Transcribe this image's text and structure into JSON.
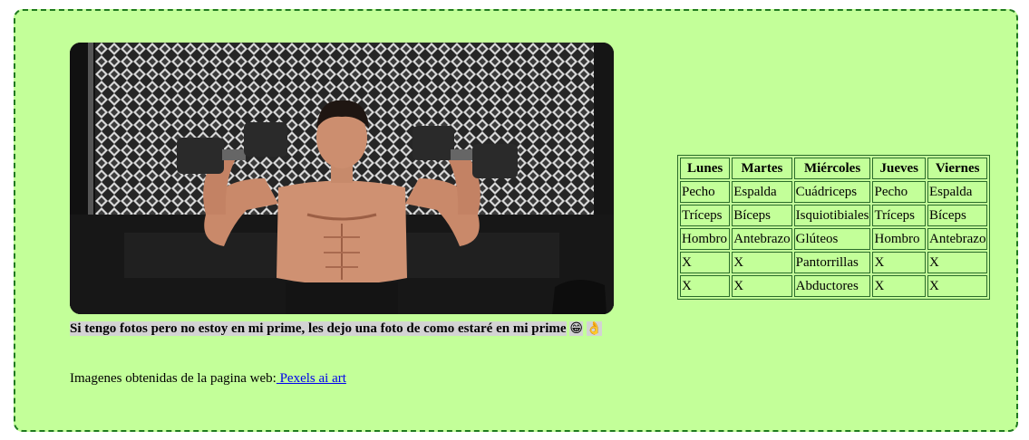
{
  "caption": {
    "text": "Si tengo fotos pero no estoy en mi prime, les dejo una foto de como estaré en mi prime",
    "emoji1": "😁",
    "emoji2": "👌"
  },
  "source": {
    "prefix": "Imagenes obtenidas de la pagina web:",
    "link_text": " Pexels ai art"
  },
  "photo": {
    "icon": "photo-of-man-lifting-dumbbells"
  },
  "schedule": {
    "headers": [
      "Lunes",
      "Martes",
      "Miércoles",
      "Jueves",
      "Viernes"
    ],
    "rows": [
      [
        "Pecho",
        "Espalda",
        "Cuádriceps",
        "Pecho",
        "Espalda"
      ],
      [
        "Tríceps",
        "Bíceps",
        "Isquiotibiales",
        "Tríceps",
        "Bíceps"
      ],
      [
        "Hombro",
        "Antebrazo",
        "Glúteos",
        "Hombro",
        "Antebrazo"
      ],
      [
        "X",
        "X",
        "Pantorrillas",
        "X",
        "X"
      ],
      [
        "X",
        "X",
        "Abductores",
        "X",
        "X"
      ]
    ]
  },
  "colors": {
    "panel_background": "#c3ff99",
    "panel_border": "#1f7a1f",
    "link": "#0000ee"
  }
}
